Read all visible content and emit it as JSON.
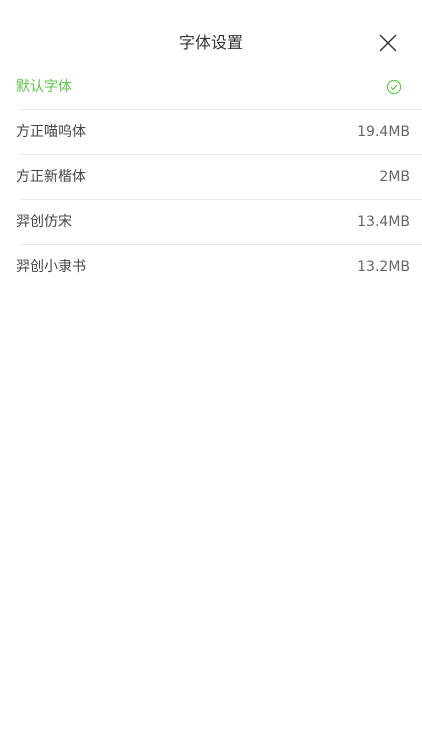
{
  "header": {
    "title": "字体设置",
    "close_icon": "close-icon"
  },
  "colors": {
    "accent": "#5dc54a",
    "text": "#444444",
    "divider": "#e8e8e8"
  },
  "fonts": [
    {
      "label": "默认字体",
      "size": "",
      "selected": true,
      "icon": "check-circle-icon"
    },
    {
      "label": "方正喵呜体",
      "size": "19.4MB",
      "selected": false
    },
    {
      "label": "方正新楷体",
      "size": "2MB",
      "selected": false
    },
    {
      "label": "羿创仿宋",
      "size": "13.4MB",
      "selected": false
    },
    {
      "label": "羿创小隶书",
      "size": "13.2MB",
      "selected": false
    }
  ]
}
